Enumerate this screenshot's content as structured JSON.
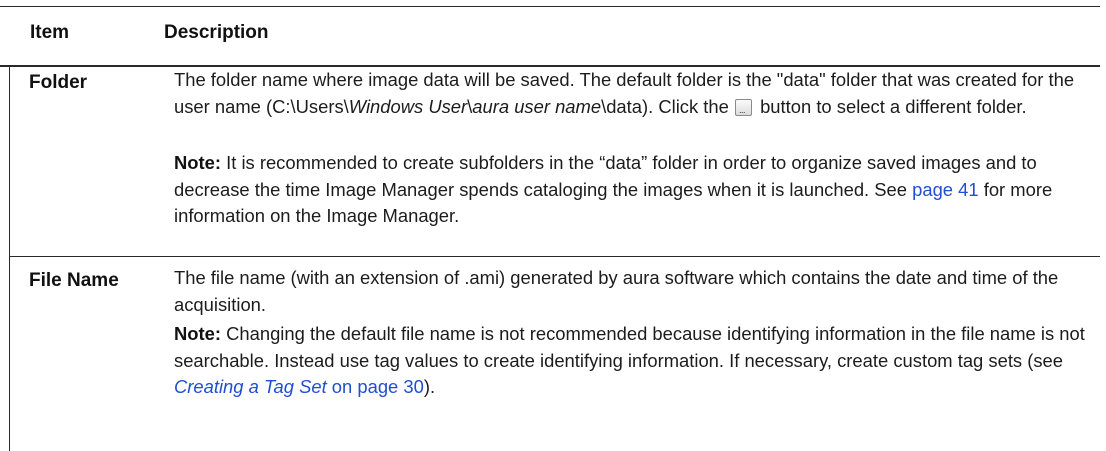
{
  "header": {
    "item": "Item",
    "description": "Description"
  },
  "rows": [
    {
      "item": "Folder",
      "desc_part1": "The folder name where image data will be saved. The default folder is the \"data\" folder that was created for the user name (C:\\Users\\",
      "desc_italic1": "Windows User",
      "desc_sep": "\\",
      "desc_italic2": "aura user name",
      "desc_part2": "\\data). Click the ",
      "browse_icon": "browse-ellipsis-icon",
      "desc_part3": " button to select a different folder.",
      "note_label": "Note:",
      "note_part1": " It is recommended to create subfolders in the “data” folder in order to organize saved images and to decrease the time Image Manager spends cataloging the images when it is launched. See ",
      "note_link": "page 41",
      "note_part2": " for more information on the Image Manager."
    },
    {
      "item": "File Name",
      "desc": "The file name (with an extension of .ami) generated by aura software which contains the date and time of the acquisition.",
      "note_label": "Note:",
      "note_part1": " Changing the default file name is not recommended because identifying information in the file name is not searchable. Instead use tag values to create identifying information. If necessary, create custom tag sets (see ",
      "note_link_italic": "Creating a Tag Set",
      "note_link_rest": " on page 30",
      "note_part2": ")."
    }
  ],
  "colors": {
    "link": "#1f4fd1",
    "rule": "#2a2a2a"
  }
}
